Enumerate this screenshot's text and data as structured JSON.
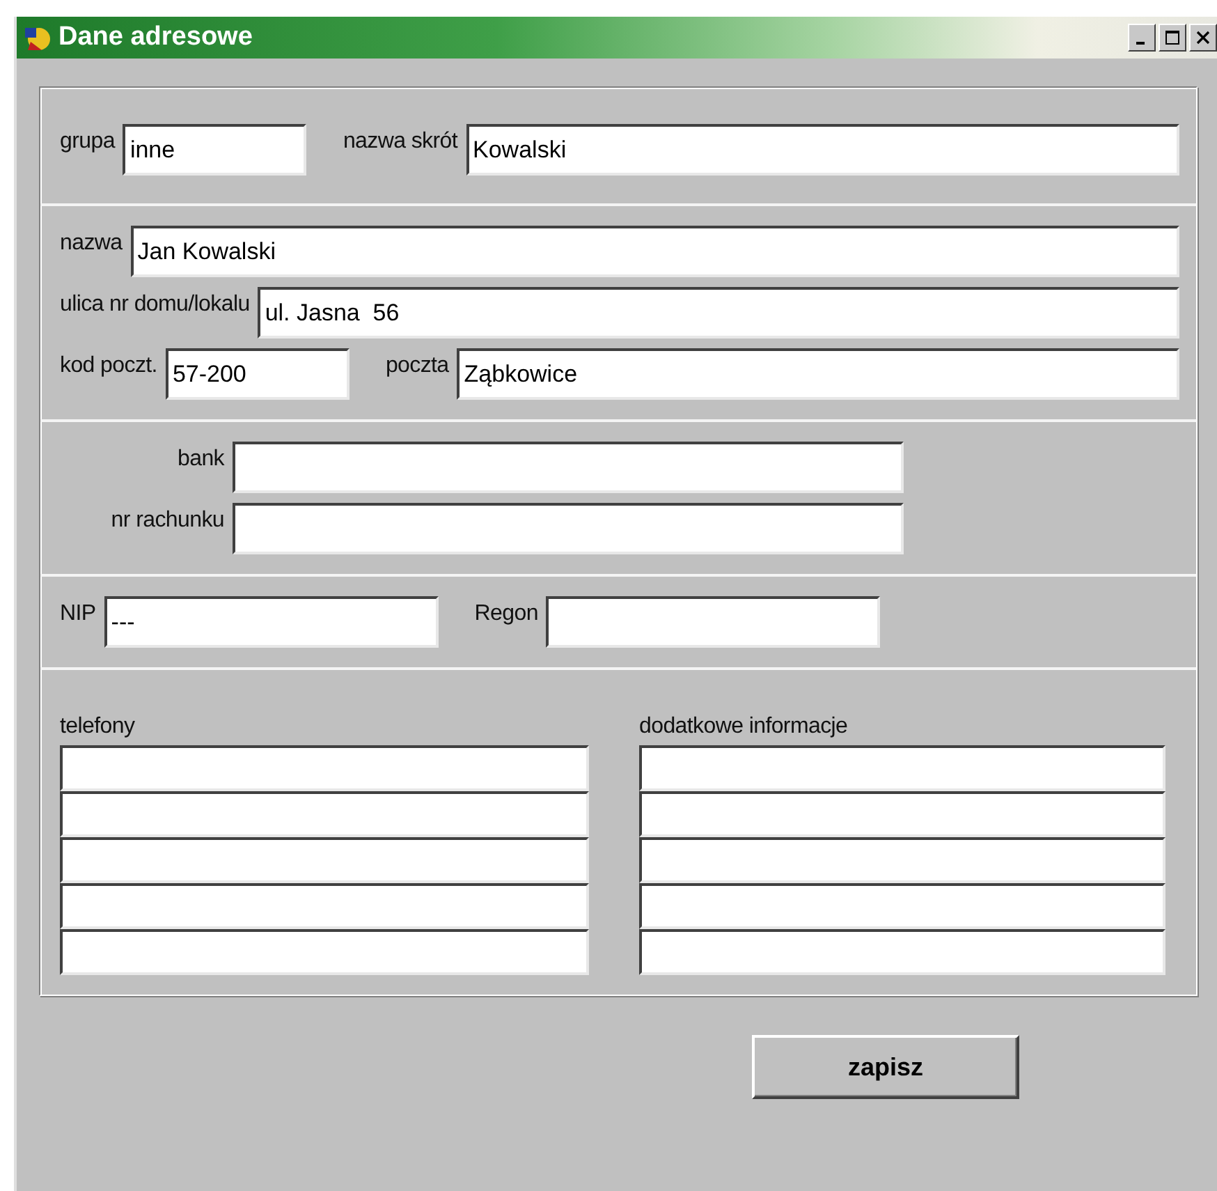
{
  "window": {
    "title": "Dane adresowe"
  },
  "sections": [
    {
      "kind": "rows",
      "rows": [
        [
          {
            "label": "grupa",
            "value": "inne"
          },
          {
            "label": "nazwa skrót",
            "value": "Kowalski"
          }
        ]
      ]
    },
    {
      "kind": "rows",
      "rows": [
        [
          {
            "label": "nazwa",
            "value": "Jan Kowalski"
          }
        ],
        [
          {
            "label": "ulica nr domu/lokalu",
            "value": "ul. Jasna  56"
          }
        ],
        [
          {
            "label": "kod poczt.",
            "value": "57-200"
          },
          {
            "label": "poczta",
            "value": "Ząbkowice"
          }
        ]
      ]
    },
    {
      "kind": "aligned",
      "rows": [
        [
          {
            "label": "bank"
          }
        ],
        [
          {
            "label": "nr rachunku"
          }
        ]
      ]
    },
    {
      "kind": "rows",
      "rows": [
        [
          {
            "label": "NIP",
            "value": "---"
          },
          {
            "label": "Regon"
          }
        ]
      ]
    },
    {
      "kind": "lists",
      "lists": [
        {
          "label": "telefony",
          "lines": [
            {
              "kind": "line"
            },
            {
              "kind": "line"
            },
            {
              "kind": "line"
            },
            {
              "kind": "line"
            },
            {
              "kind": "line"
            }
          ]
        },
        {
          "label": "dodatkowe informacje",
          "lines": [
            {
              "kind": "line"
            },
            {
              "kind": "line"
            },
            {
              "kind": "line"
            },
            {
              "kind": "line"
            },
            {
              "kind": "line"
            }
          ]
        }
      ]
    }
  ],
  "button": "zapisz"
}
